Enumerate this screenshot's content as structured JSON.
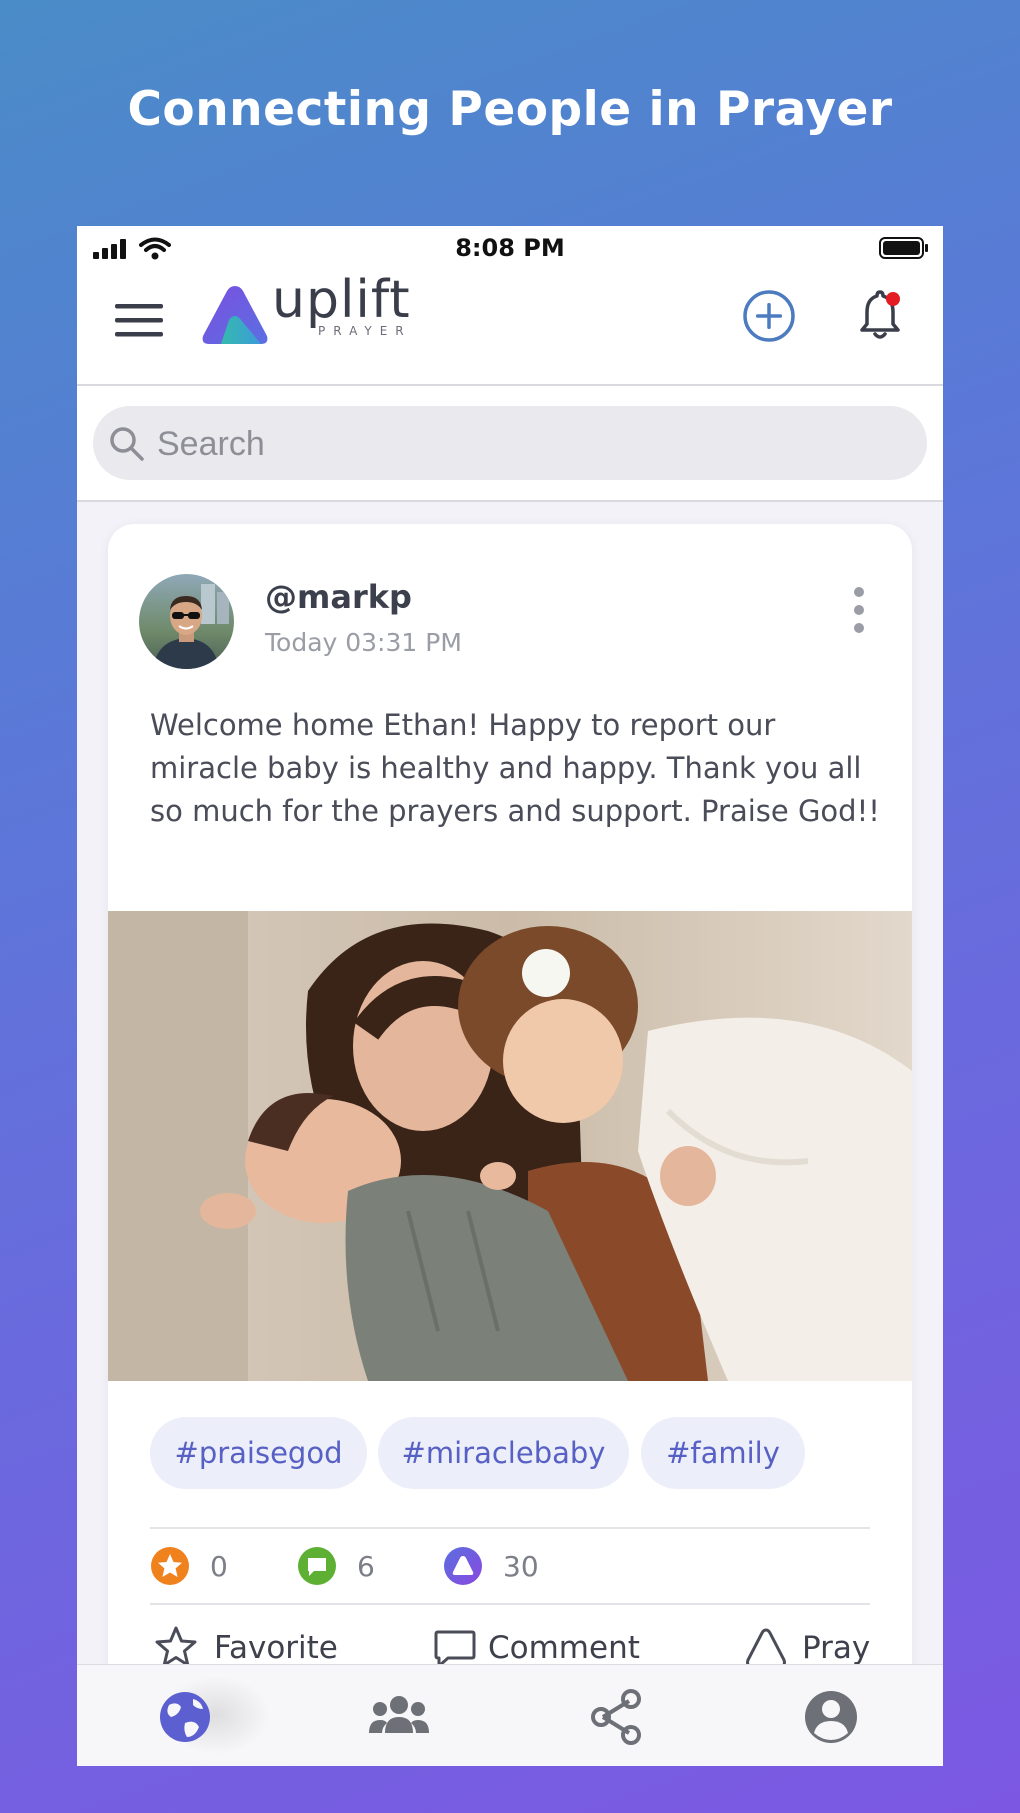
{
  "headline": "Connecting People in Prayer",
  "status_bar": {
    "time": "8:08 PM"
  },
  "app": {
    "logo_word": "uplift",
    "logo_sub": "PRAYER"
  },
  "search": {
    "placeholder": "Search"
  },
  "post": {
    "username": "@markp",
    "timestamp": "Today 03:31 PM",
    "text": "Welcome home Ethan! Happy to report our miracle baby is healthy and happy. Thank you all so much for the prayers and support. Praise God!!",
    "tags": [
      "#praisegod",
      "#miraclebaby",
      "#family"
    ],
    "stats": {
      "favorites": "0",
      "comments": "6",
      "prayers": "30"
    },
    "actions": {
      "favorite": "Favorite",
      "comment": "Comment",
      "pray": "Pray"
    }
  },
  "colors": {
    "accent": "#5760c4",
    "favorite_icon": "#f0821e",
    "comment_icon": "#5db033",
    "pray_icon": "#7a55e0",
    "notification_dot": "#e41b23",
    "add_icon": "#4c7cbf"
  },
  "bottom_nav": [
    "globe-icon",
    "people-icon",
    "share-icon",
    "profile-icon"
  ]
}
